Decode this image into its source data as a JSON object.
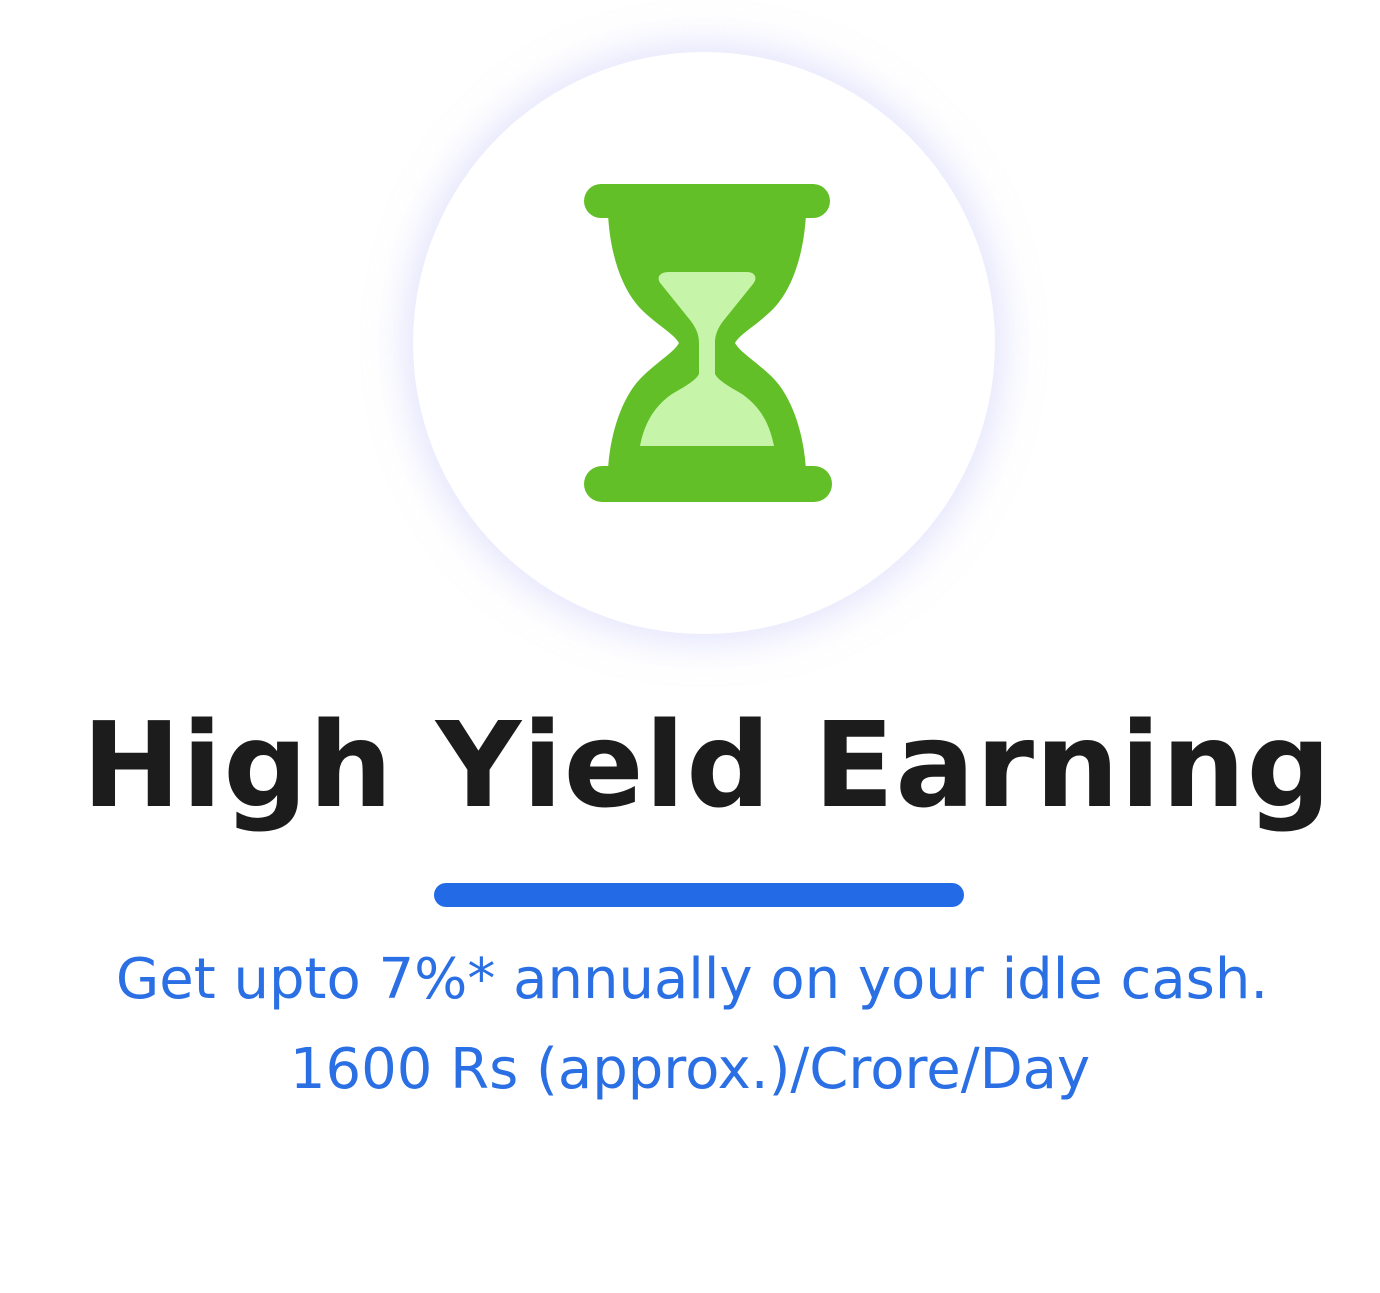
{
  "feature": {
    "icon": "hourglass-icon",
    "title": "High Yield Earning",
    "description_line_1": "Get upto 7%* annually on your idle cash.",
    "description_line_2": "1600 Rs (approx.)/Crore/Day"
  },
  "colors": {
    "icon_primary": "#62bf27",
    "icon_sand": "#c6f5aa",
    "title": "#1c1c1c",
    "accent": "#236be6",
    "description": "#2a6fe3",
    "circle_glow": "#cdd0fa"
  }
}
